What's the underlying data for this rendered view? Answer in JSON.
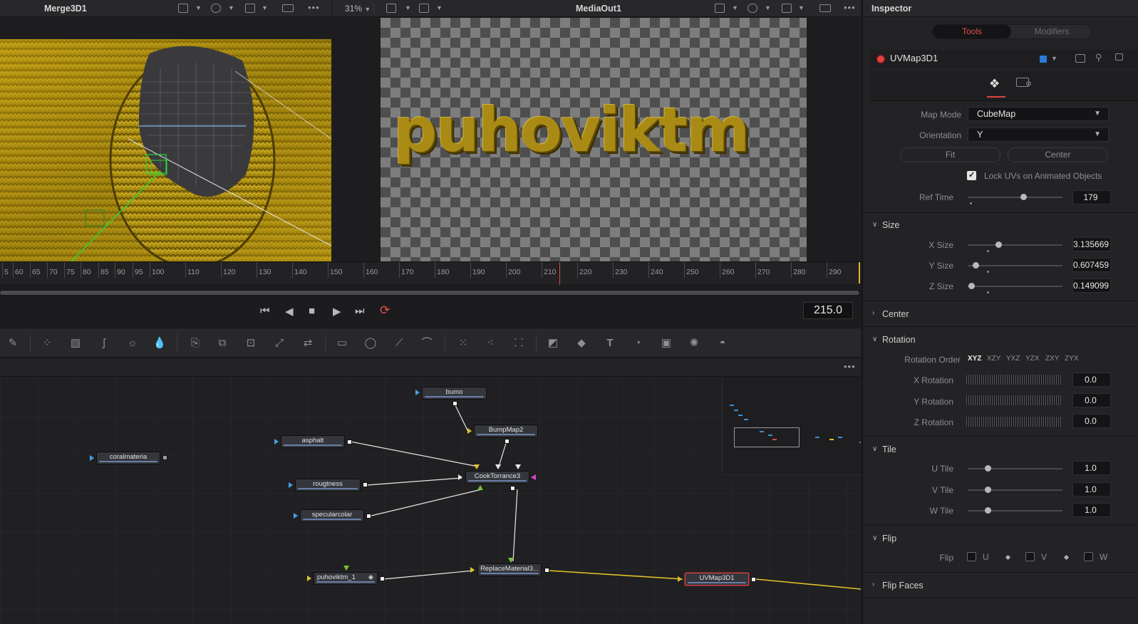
{
  "left_viewer": {
    "title": "Merge3D1"
  },
  "right_viewer": {
    "title": "MediaOut1",
    "zoom": "31%",
    "render_text": "puhoviktm"
  },
  "ruler": {
    "labels": [
      "5",
      "60",
      "65",
      "70",
      "75",
      "80",
      "85",
      "90",
      "95",
      "100",
      "110",
      "120",
      "130",
      "140",
      "150",
      "160",
      "170",
      "180",
      "190",
      "200",
      "210",
      "220",
      "230",
      "240",
      "250",
      "260",
      "270",
      "280",
      "290"
    ]
  },
  "transport": {
    "current_frame": "215.0"
  },
  "nodes": {
    "bumo": "bumo",
    "bumpmap": "BumpMap2",
    "asphalt": "asphalt",
    "coral": "coralmateria",
    "cook": "CookTorrance3",
    "rough": "rougtness",
    "specular": "specularcolar",
    "puhov": "puhoviktm_1",
    "replace": "ReplaceMaterial3...",
    "uvmap": "UVMap3D1"
  },
  "inspector": {
    "title": "Inspector",
    "tabs": {
      "tools": "Tools",
      "modifiers": "Modifiers"
    },
    "tool_name": "UVMap3D1",
    "map_mode": {
      "label": "Map Mode",
      "value": "CubeMap"
    },
    "orientation": {
      "label": "Orientation",
      "value": "Y"
    },
    "fit_button": "Fit",
    "center_button": "Center",
    "lock_uvs": {
      "label": "Lock UVs on Animated Objects",
      "checked": true
    },
    "ref_time": {
      "label": "Ref Time",
      "value": "179"
    },
    "size": {
      "title": "Size",
      "x": {
        "label": "X Size",
        "value": "3.135669"
      },
      "y": {
        "label": "Y Size",
        "value": "0.607459"
      },
      "z": {
        "label": "Z Size",
        "value": "0.149099"
      }
    },
    "center_section": "Center",
    "rotation": {
      "title": "Rotation",
      "order_label": "Rotation Order",
      "orders": [
        "XYZ",
        "XZY",
        "YXZ",
        "YZX",
        "ZXY",
        "ZYX"
      ],
      "x": {
        "label": "X Rotation",
        "value": "0.0"
      },
      "y": {
        "label": "Y Rotation",
        "value": "0.0"
      },
      "z": {
        "label": "Z Rotation",
        "value": "0.0"
      }
    },
    "tile": {
      "title": "Tile",
      "u": {
        "label": "U Tile",
        "value": "1.0"
      },
      "v": {
        "label": "V Tile",
        "value": "1.0"
      },
      "w": {
        "label": "W Tile",
        "value": "1.0"
      }
    },
    "flip": {
      "title": "Flip",
      "label": "Flip",
      "u": "U",
      "v": "V",
      "w": "W"
    },
    "flip_faces": "Flip Faces"
  },
  "colors": {
    "accent_red": "#e0504a",
    "playhead": "#d94646",
    "wire_yellow": "#e2c02a"
  }
}
